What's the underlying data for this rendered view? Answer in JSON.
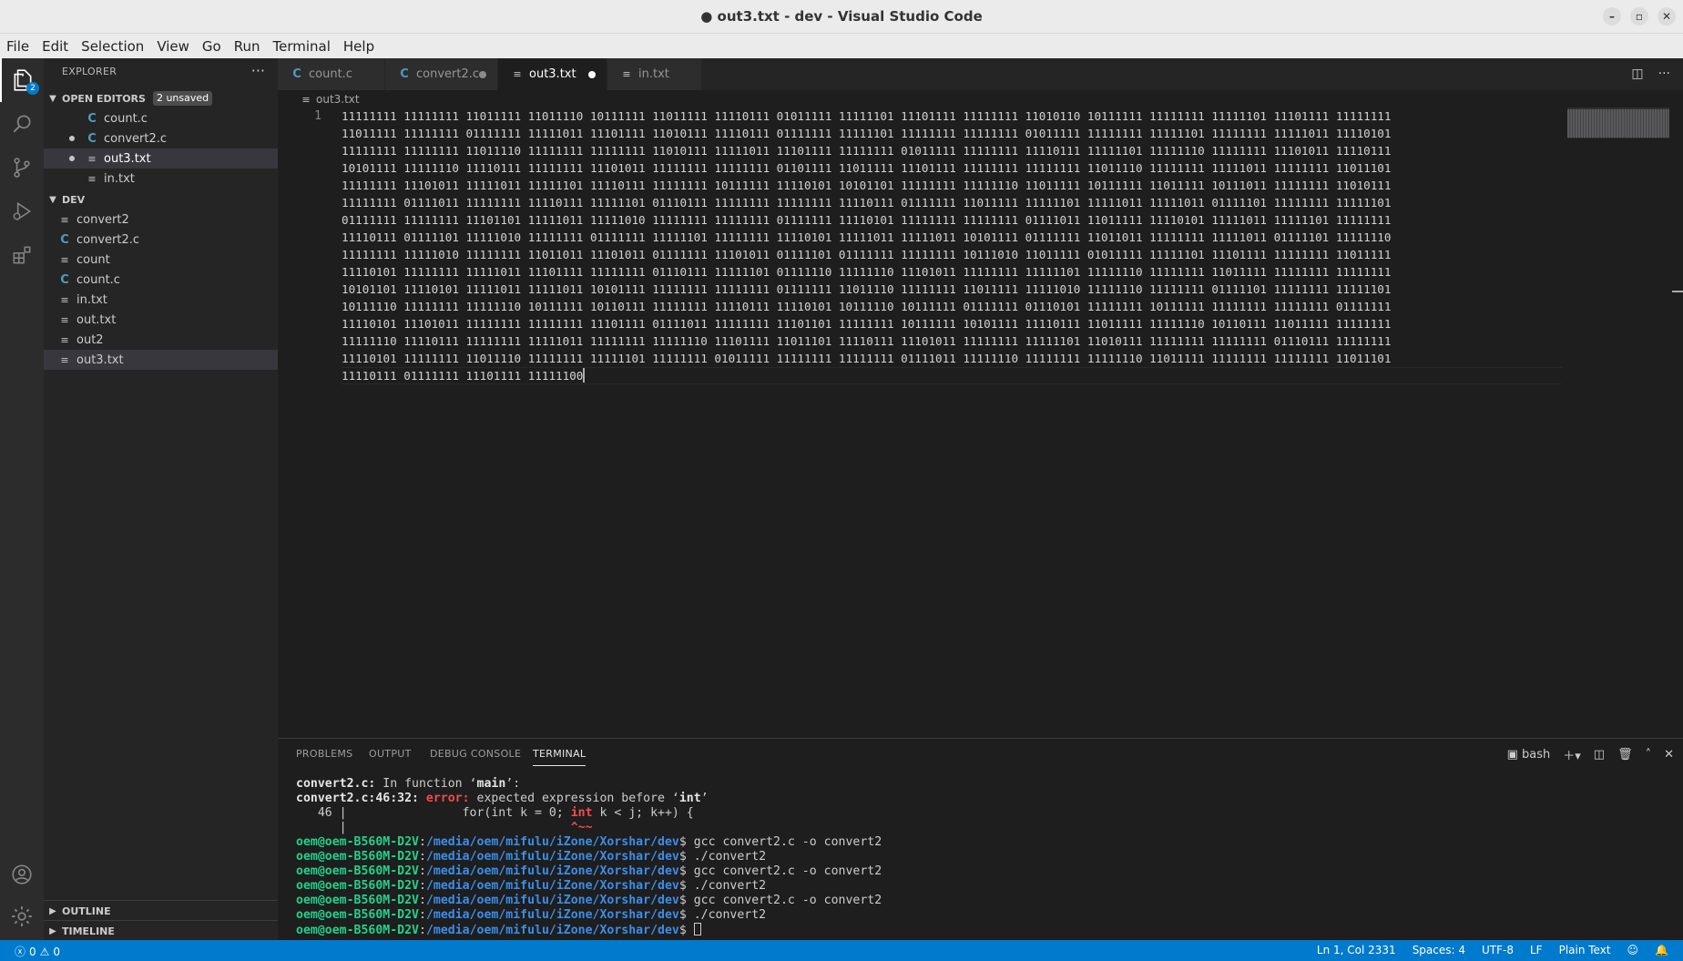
{
  "window": {
    "title": "● out3.txt - dev - Visual Studio Code",
    "controls": [
      "–",
      "▫",
      "✕"
    ]
  },
  "menu": [
    "File",
    "Edit",
    "Selection",
    "View",
    "Go",
    "Run",
    "Terminal",
    "Help"
  ],
  "activity_bar": {
    "badge": "2",
    "items": [
      "files-icon",
      "search-icon",
      "source-control-icon",
      "run-debug-icon",
      "extensions-icon",
      "account-icon",
      "gear-icon"
    ]
  },
  "sidebar": {
    "title": "EXPLORER",
    "more": "···",
    "open_editors": {
      "label": "OPEN EDITORS",
      "badge": "2 unsaved",
      "items": [
        {
          "name": "count.c",
          "type": "c",
          "dirty": false
        },
        {
          "name": "convert2.c",
          "type": "c",
          "dirty": true
        },
        {
          "name": "out3.txt",
          "type": "txt",
          "dirty": true
        },
        {
          "name": "in.txt",
          "type": "txt",
          "dirty": false
        }
      ]
    },
    "folder": {
      "label": "DEV",
      "items": [
        {
          "name": "convert2",
          "type": "txt"
        },
        {
          "name": "convert2.c",
          "type": "c"
        },
        {
          "name": "count",
          "type": "txt"
        },
        {
          "name": "count.c",
          "type": "c"
        },
        {
          "name": "in.txt",
          "type": "txt"
        },
        {
          "name": "out.txt",
          "type": "txt"
        },
        {
          "name": "out2",
          "type": "txt"
        },
        {
          "name": "out3.txt",
          "type": "txt"
        }
      ]
    },
    "outline": "OUTLINE",
    "timeline": "TIMELINE"
  },
  "tabs": [
    {
      "label": "count.c",
      "icon": "C"
    },
    {
      "label": "convert2.c",
      "icon": "C"
    },
    {
      "label": "out3.txt",
      "icon": "≡"
    },
    {
      "label": "in.txt",
      "icon": "≡"
    }
  ],
  "breadcrumb": "out3.txt",
  "editor": {
    "line_number": "1",
    "lines": [
      "11111111 11111111 11011111 11011110 10111111 11011111 11110111 01011111 11111101 11101111 11111111 11010110 10111111 11111111 11111101 11101111 11111111",
      "11011111 11111111 01111111 11111011 11101111 11010111 11110111 01111111 11111101 11111111 11111111 01011111 11111111 11111101 11111111 11111011 11110101",
      "11111111 11111111 11011110 11111111 11111111 11010111 11111011 11101111 11111111 01011111 11111111 11110111 11111101 11111110 11111111 11101011 11110111",
      "10101111 11111110 11110111 11111111 11101011 11111111 11111111 01101111 11011111 11101111 11111111 11111111 11011110 11111111 11111011 11111111 11011101",
      "11111111 11101011 11111011 11111101 11110111 11111111 10111111 11110101 10101101 11111111 11111110 11011111 10111111 11011111 10111011 11111111 11010111",
      "11111111 01111011 11111111 11110111 11111101 01110111 11111111 11111111 11110111 01111111 11011111 11111101 11111011 11111011 01111101 11111111 11111101",
      "01111111 11111111 11101101 11111011 11111010 11111111 11111111 01111111 11110101 11111111 11111111 01111011 11011111 11110101 11111011 11111101 11111111",
      "11110111 01111101 11111010 11111111 01111111 11111101 11111111 11110101 11111011 11111011 10101111 01111111 11011011 11111111 11111011 01111101 11111110",
      "11111111 11111010 11111111 11011011 11101011 01111111 11101011 01111101 01111111 11111111 10111010 11011111 01011111 11111101 11101111 11111111 11011111",
      "11110101 11111111 11111011 11101111 11111111 01110111 11111101 01111110 11111110 11101011 11111111 11111101 11111110 11111111 11011111 11111111 11111111",
      "10101101 11110101 11111011 11111011 10101111 11111111 11111111 01111111 11011110 11111111 11011111 11111010 11111110 11111111 01111101 11111111 11111101",
      "10111110 11111111 11111110 10111111 10110111 11111111 11110111 11110101 10111110 10111111 01111111 01110101 11111111 10111111 11111111 11111111 01111111",
      "11110101 11101011 11111111 11111111 11101111 01111011 11111111 11101101 11111111 10111111 10101111 11110111 11011111 11111110 10110111 11011111 11111111",
      "11111110 11110111 11111111 11111011 11111111 11111110 11101111 11011101 11110111 11101011 11111111 11111101 11010111 11111111 11111111 01110111 11111111",
      "11110101 11111111 11011110 11111111 11111101 11111111 01011111 11111111 11111111 01111011 11111110 11111111 11111110 11011111 11111111 11111111 11011101",
      "11110111 01111111 11101111 11111100"
    ]
  },
  "panel": {
    "tabs": [
      "PROBLEMS",
      "OUTPUT",
      "DEBUG CONSOLE",
      "TERMINAL"
    ],
    "shell": "bash",
    "terminal": {
      "l1_file": "convert2.c:",
      "l1_text": " In function ‘",
      "l1_fn": "main",
      "l1_end": "’:",
      "l2_loc": "convert2.c:46:32: ",
      "l2_err": "error: ",
      "l2_msg": "expected expression before ‘",
      "l2_kw": "int",
      "l2_end": "’",
      "l3_num": "   46 |",
      "l3_pre": "                for(int k = 0; ",
      "l3_hl": "int",
      "l3_post": " k < j; k++) {",
      "l4_bar": "      |",
      "l4_caret": "                               ^~~",
      "user": "oem@oem-B560M-D2V",
      "path": "/media/oem/mifulu/iZone/Xorshar/dev",
      "commands": [
        "gcc convert2.c -o convert2",
        "./convert2",
        "gcc convert2.c -o convert2",
        "./convert2",
        "gcc convert2.c -o convert2",
        "./convert2",
        ""
      ]
    }
  },
  "status": {
    "errors": "0",
    "warnings": "0",
    "position": "Ln 1, Col 2331",
    "spaces": "Spaces: 4",
    "encoding": "UTF-8",
    "eol": "LF",
    "language": "Plain Text"
  }
}
